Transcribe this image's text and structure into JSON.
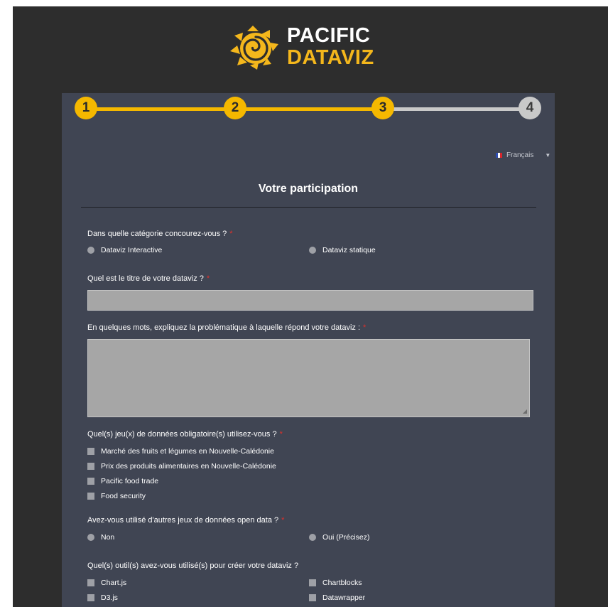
{
  "brand": {
    "line1": "PACIFIC",
    "line2": "DATAVIZ",
    "accent_color": "#f4b71c",
    "icon": "sun-swirl-icon"
  },
  "stepper": {
    "current_step": 3,
    "steps": [
      {
        "label": "1",
        "state": "done"
      },
      {
        "label": "2",
        "state": "done"
      },
      {
        "label": "3",
        "state": "current"
      },
      {
        "label": "4",
        "state": "todo"
      }
    ],
    "active_color": "#f5b800",
    "inactive_color": "#c9c9c9"
  },
  "language": {
    "selected": "Français",
    "flag": "france-flag-icon"
  },
  "form": {
    "title": "Votre participation",
    "required_marker": "*",
    "category": {
      "question": "Dans quelle catégorie concourez-vous ?",
      "options": [
        "Dataviz Interactive",
        "Dataviz statique"
      ]
    },
    "dataviz_title": {
      "question": "Quel est le titre de votre dataviz ?",
      "value": "",
      "placeholder": ""
    },
    "problem": {
      "question": "En quelques mots, expliquez la problématique à laquelle répond votre dataviz :",
      "value": "",
      "placeholder": ""
    },
    "datasets": {
      "question": "Quel(s) jeu(x) de données obligatoire(s) utilisez-vous ?",
      "options": [
        "Marché des fruits et légumes en Nouvelle-Calédonie",
        "Prix des produits alimentaires en Nouvelle-Calédonie",
        "Pacific food trade",
        "Food security"
      ]
    },
    "other_data": {
      "question": "Avez-vous utilisé d'autres jeux de données open data ?",
      "options": [
        "Non",
        "Oui (Précisez)"
      ]
    },
    "tools": {
      "question": "Quel(s) outil(s) avez-vous utilisé(s) pour créer votre dataviz ?",
      "options": [
        "Chart.js",
        "Chartblocks",
        "D3.js",
        "Datawrapper"
      ]
    }
  }
}
